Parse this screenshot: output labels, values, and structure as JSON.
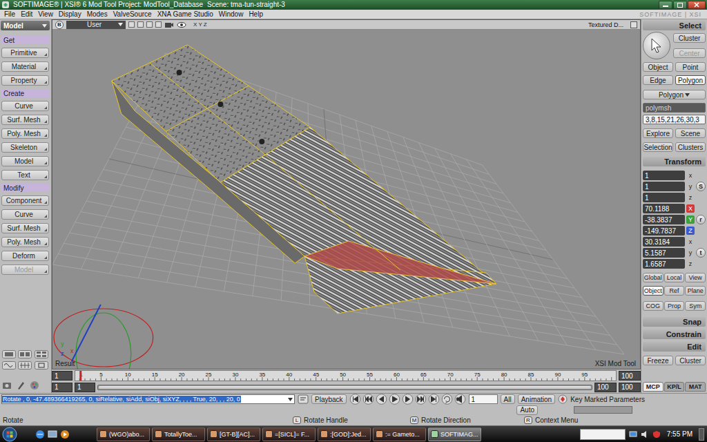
{
  "window": {
    "title": "SOFTIMAGE® | XSI® 6 Mod Tool Project: ModTool_Database",
    "scene": "Scene: tma-tun-straight-3"
  },
  "menu": [
    "File",
    "Edit",
    "View",
    "Display",
    "Modes",
    "ValveSource",
    "XNA Game Studio",
    "Window",
    "Help"
  ],
  "logo": "SOFTIMAGE | XSI",
  "left_panel": {
    "mode": "Model",
    "sections": [
      {
        "title": "Get",
        "buttons": [
          {
            "label": "Primitive",
            "disabled": false
          },
          {
            "label": "Material",
            "disabled": false
          },
          {
            "label": "Property",
            "disabled": false
          }
        ]
      },
      {
        "title": "Create",
        "buttons": [
          {
            "label": "Curve",
            "disabled": false
          },
          {
            "label": "Surf. Mesh",
            "disabled": false
          },
          {
            "label": "Poly. Mesh",
            "disabled": false
          },
          {
            "label": "Skeleton",
            "disabled": false
          },
          {
            "label": "Model",
            "disabled": false
          },
          {
            "label": "Text",
            "disabled": false
          }
        ]
      },
      {
        "title": "Modify",
        "buttons": [
          {
            "label": "Component",
            "disabled": false
          },
          {
            "label": "Curve",
            "disabled": false
          },
          {
            "label": "Surf. Mesh",
            "disabled": false
          },
          {
            "label": "Poly. Mesh",
            "disabled": false
          },
          {
            "label": "Deform",
            "disabled": false
          },
          {
            "label": "Model",
            "disabled": true
          }
        ]
      }
    ]
  },
  "viewport": {
    "view": "B",
    "camera": "User",
    "axes": "X Y Z",
    "display": "Textured D...",
    "label": "Result",
    "watermark": "XSI Mod Tool",
    "gizmo": [
      {
        "label": "y",
        "color": "#2a9a2a"
      },
      {
        "label": "z",
        "color": "#2040c0"
      },
      {
        "label": "x",
        "color": "#c02020"
      }
    ]
  },
  "right_panel": {
    "select": {
      "title": "Select",
      "buttons": [
        {
          "label": "Cluster",
          "disabled": false
        },
        {
          "label": "Center",
          "disabled": true
        }
      ],
      "filters": [
        {
          "label": "Object",
          "selected": false
        },
        {
          "label": "Point",
          "selected": false
        },
        {
          "label": "Edge",
          "selected": false
        },
        {
          "label": "Polygon",
          "selected": true
        }
      ],
      "filter_menu": "Polygon",
      "object": "polymsh",
      "components": "3,8,15,21,26,30,3",
      "actions": [
        "Explore",
        "Scene",
        "Selection",
        "Clusters"
      ]
    },
    "transform": {
      "title": "Transform",
      "groups": [
        {
          "kind": "scale",
          "button": "S",
          "values": [
            {
              "axis": "x",
              "value": "1"
            },
            {
              "axis": "y",
              "value": "1"
            },
            {
              "axis": "z",
              "value": "1"
            }
          ]
        },
        {
          "kind": "rotate",
          "button": "r",
          "values": [
            {
              "axis": "X",
              "value": "70.1188",
              "color": "#d23a3a"
            },
            {
              "axis": "Y",
              "value": "-38.3837",
              "color": "#3aa040"
            },
            {
              "axis": "Z",
              "value": "-149.7837",
              "color": "#3a5ad0"
            }
          ]
        },
        {
          "kind": "translate",
          "button": "t",
          "values": [
            {
              "axis": "x",
              "value": "30.3184"
            },
            {
              "axis": "y",
              "value": "5.1587"
            },
            {
              "axis": "z",
              "value": "1.6587"
            }
          ]
        }
      ],
      "modes": [
        [
          {
            "label": "Global",
            "selected": false
          },
          {
            "label": "Local",
            "selected": false
          },
          {
            "label": "View",
            "selected": false
          }
        ],
        [
          {
            "label": "Object",
            "selected": true
          },
          {
            "label": "Ref",
            "selected": false
          },
          {
            "label": "Plane",
            "selected": false
          }
        ],
        [
          {
            "label": "COG",
            "selected": false
          },
          {
            "label": "Prop",
            "selected": false
          },
          {
            "label": "Sym",
            "selected": false
          }
        ]
      ]
    },
    "sections": [
      "Snap",
      "Constrain",
      "Edit"
    ],
    "edit_buttons": [
      "Freeze",
      "Cluster"
    ],
    "tabs": [
      {
        "label": "MCP",
        "selected": true
      },
      {
        "label": "KP/L",
        "selected": false
      },
      {
        "label": "MAT",
        "selected": false
      }
    ]
  },
  "timeline": {
    "start": "1",
    "end": "100",
    "ticks": [
      "1",
      "5",
      "10",
      "15",
      "20",
      "25",
      "30",
      "35",
      "40",
      "45",
      "50",
      "55",
      "60",
      "65",
      "70",
      "75",
      "80",
      "85",
      "90",
      "95"
    ],
    "level": 0,
    "range": [
      "1",
      "1",
      "100",
      "100"
    ]
  },
  "command": {
    "text": "Rotate , 0, -47.489366419265, 0, siRelative, siAdd, siObj, siXYZ, , , , True, 20, , , 20, 0",
    "selected": true
  },
  "playback": {
    "button": "Playback",
    "frame": "1",
    "scope": "All",
    "mode": "Animation",
    "auto": "Auto",
    "keys": "Key Marked Parameters"
  },
  "status": {
    "tool": "Rotate",
    "hints": [
      {
        "key": "L",
        "label": "Rotate Handle"
      },
      {
        "key": "M",
        "label": "Rotate Direction"
      },
      {
        "key": "R",
        "label": "Context Menu"
      }
    ]
  },
  "taskbar": {
    "tasks": [
      {
        "label": "(WGO)abo...",
        "selected": false
      },
      {
        "label": "TotallyToe...",
        "selected": false
      },
      {
        "label": "[GT-B][AC]...",
        "selected": false
      },
      {
        "label": "=[SICL]= F...",
        "selected": false
      },
      {
        "label": ":[GOD]:Jed...",
        "selected": false
      },
      {
        "label": ":= Gameto...",
        "selected": false
      },
      {
        "label": "SOFTIMAG...",
        "selected": true
      }
    ],
    "clock": "7:55 PM"
  }
}
